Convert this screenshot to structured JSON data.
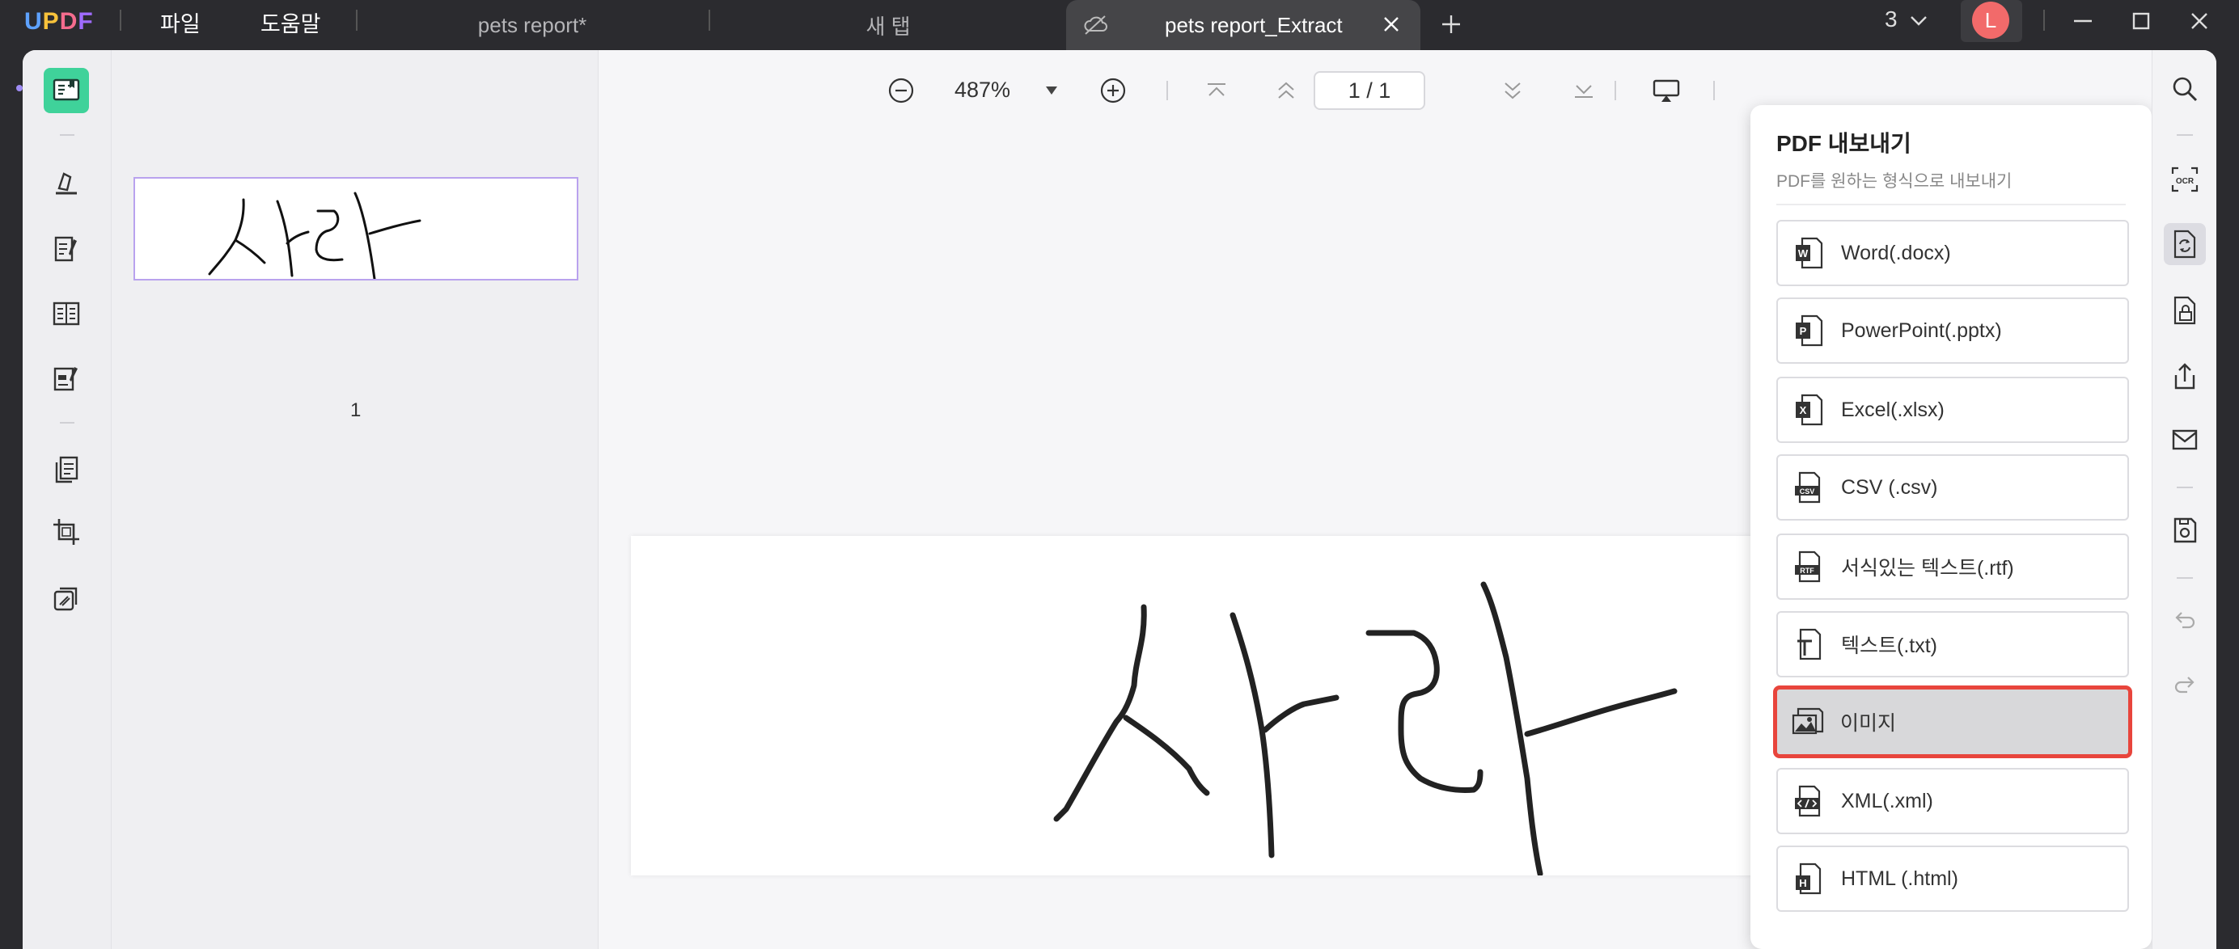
{
  "titlebar": {
    "logo_letters": [
      "U",
      "P",
      "D",
      "F"
    ],
    "logo_colors": [
      "#5ea2ff",
      "#f7c23b",
      "#f56c8e",
      "#9f6bff"
    ],
    "menu": {
      "file": "파일",
      "help": "도움말"
    },
    "tabs": [
      {
        "label": "pets report*"
      },
      {
        "label": "새 탭"
      },
      {
        "label": "pets report_Extract",
        "active": true
      }
    ],
    "window_count": "3",
    "avatar_initial": "L"
  },
  "page_toolbar": {
    "zoom": "487%",
    "page_indicator": "1 / 1"
  },
  "thumbnails": [
    {
      "page_number": "1",
      "selected": true
    }
  ],
  "document": {
    "handwriting_text": "사라"
  },
  "export_panel": {
    "title": "PDF 내보내기",
    "subtitle": "PDF를 원하는 형식으로 내보내기",
    "items": [
      {
        "label": "Word(.docx)",
        "icon": "word-icon"
      },
      {
        "label": "PowerPoint(.pptx)",
        "icon": "powerpoint-icon"
      },
      {
        "label": "Excel(.xlsx)",
        "icon": "excel-icon"
      },
      {
        "label": "CSV (.csv)",
        "icon": "csv-icon"
      },
      {
        "label": "서식있는 텍스트(.rtf)",
        "icon": "rtf-icon"
      },
      {
        "label": "텍스트(.txt)",
        "icon": "txt-icon"
      },
      {
        "label": "이미지",
        "icon": "image-icon",
        "selected": true
      },
      {
        "label": "XML(.xml)",
        "icon": "xml-icon"
      },
      {
        "label": "HTML (.html)",
        "icon": "html-icon"
      }
    ],
    "highlight_color": "#e8453c"
  },
  "colors": {
    "accent_green": "#3fd29a",
    "thumbnail_border": "#b9a2ee",
    "avatar": "#f26a6a"
  }
}
